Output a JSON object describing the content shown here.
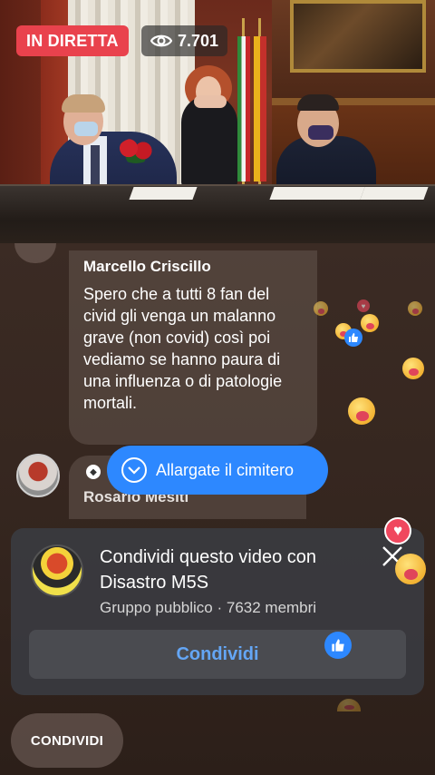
{
  "live": {
    "badge": "IN DIRETTA",
    "viewers": "7.701"
  },
  "comments": [
    {
      "author": "Marcello Criscillo",
      "text": "Spero che a tutti 8 fan del civid gli venga un malanno grave (non covid)  così poi vediamo se hanno paura di una influenza o di patologie mortali."
    },
    {
      "author": "Rosario Mesiti"
    }
  ],
  "new_comment_pill": {
    "label": "Allargate il cimitero"
  },
  "share_card": {
    "title": "Condividi questo video con Disastro M5S",
    "subtitle": "Gruppo pubblico · 7632 membri",
    "button": "Condividi"
  },
  "bottom_bar": {
    "share_label": "CONDIVIDI"
  },
  "colors": {
    "live_red": "#e9424d",
    "fb_blue": "#2d88ff",
    "link_blue": "#64a6f5"
  },
  "icons": [
    "eye-icon",
    "chevron-down-icon",
    "close-icon",
    "like-icon",
    "heart-icon",
    "care-reaction-icon"
  ]
}
